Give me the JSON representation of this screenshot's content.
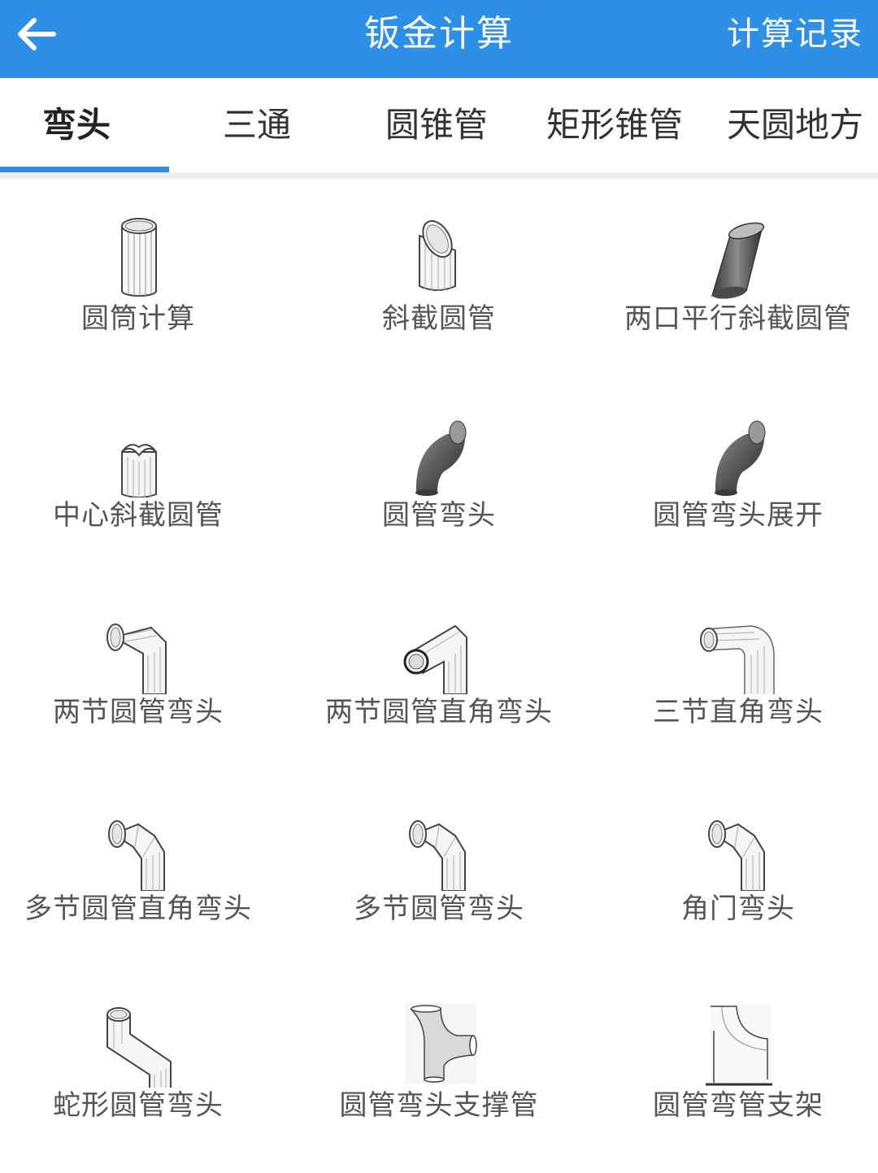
{
  "header": {
    "back_icon": "arrow-left-icon",
    "title": "钣金计算",
    "history_label": "计算记录",
    "accent_color": "#2e8fe6"
  },
  "tabs": [
    {
      "label": "弯头",
      "active": true
    },
    {
      "label": "三通",
      "active": false
    },
    {
      "label": "圆锥管",
      "active": false
    },
    {
      "label": "矩形锥管",
      "active": false
    },
    {
      "label": "天圆地方",
      "active": false
    }
  ],
  "items": [
    {
      "label": "圆筒计算",
      "icon": "cylinder-icon"
    },
    {
      "label": "斜截圆管",
      "icon": "oblique-cut-pipe-icon"
    },
    {
      "label": "两口平行斜截圆管",
      "icon": "parallel-oblique-pipe-icon"
    },
    {
      "label": "中心斜截圆管",
      "icon": "center-oblique-pipe-icon"
    },
    {
      "label": "圆管弯头",
      "icon": "pipe-elbow-icon"
    },
    {
      "label": "圆管弯头展开",
      "icon": "pipe-elbow-unfold-icon"
    },
    {
      "label": "两节圆管弯头",
      "icon": "two-section-elbow-icon"
    },
    {
      "label": "两节圆管直角弯头",
      "icon": "two-section-right-elbow-icon"
    },
    {
      "label": "三节直角弯头",
      "icon": "three-section-right-elbow-icon"
    },
    {
      "label": "多节圆管直角弯头",
      "icon": "multi-section-right-elbow-icon"
    },
    {
      "label": "多节圆管弯头",
      "icon": "multi-section-elbow-icon"
    },
    {
      "label": "角门弯头",
      "icon": "corner-elbow-icon"
    },
    {
      "label": "蛇形圆管弯头",
      "icon": "snake-elbow-icon"
    },
    {
      "label": "圆管弯头支撑管",
      "icon": "elbow-support-pipe-icon"
    },
    {
      "label": "圆管弯管支架",
      "icon": "pipe-bend-bracket-icon"
    }
  ]
}
